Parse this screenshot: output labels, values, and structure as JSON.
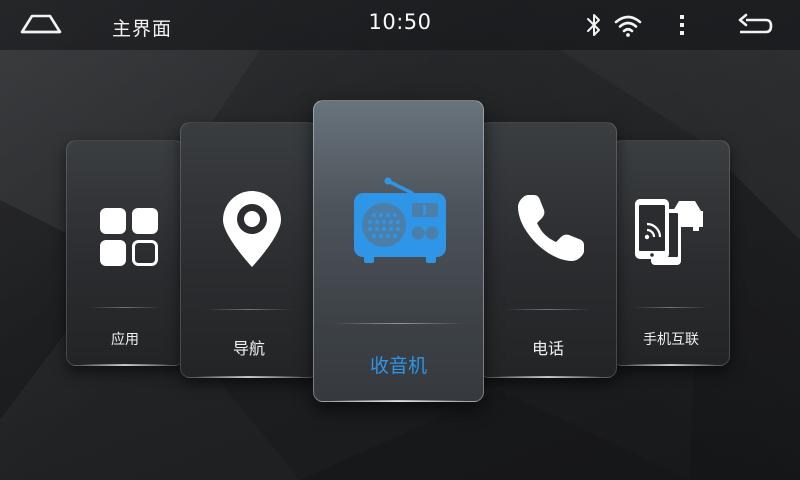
{
  "statusbar": {
    "title": "主界面",
    "clock": "10:50",
    "icons": [
      "home-icon",
      "bluetooth-icon",
      "wifi-icon",
      "more-vertical-icon",
      "back-icon"
    ]
  },
  "cards": [
    {
      "id": "apps",
      "label": "应用",
      "icon": "apps-grid-icon",
      "selected": false
    },
    {
      "id": "nav",
      "label": "导航",
      "icon": "location-pin-icon",
      "selected": false
    },
    {
      "id": "radio",
      "label": "收音机",
      "icon": "radio-icon",
      "selected": true
    },
    {
      "id": "phone",
      "label": "电话",
      "icon": "phone-icon",
      "selected": false
    },
    {
      "id": "mirror",
      "label": "手机互联",
      "icon": "phone-car-link-icon",
      "selected": false
    }
  ],
  "colors": {
    "accent": "#2f95e6",
    "text": "#f0f0f0",
    "background": "#1e2022"
  }
}
